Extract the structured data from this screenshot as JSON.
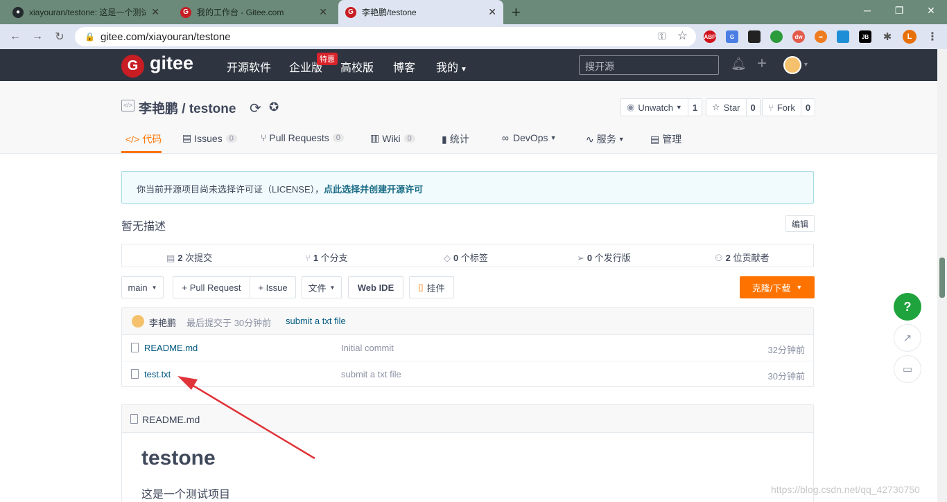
{
  "browser": {
    "tabs": [
      {
        "title": "xiayouran/testone: 这是一个测试",
        "active": false
      },
      {
        "title": "我的工作台 - Gitee.com",
        "active": false
      },
      {
        "title": "李艳鹏/testone",
        "active": true
      }
    ],
    "new_tab": "+",
    "url": "gitee.com/xiayouran/testone",
    "profile_initial": "L",
    "extensions": [
      "ABP",
      "G",
      "",
      "",
      "dw",
      "∞",
      "",
      "JB"
    ]
  },
  "header": {
    "logo": "gitee",
    "nav": [
      "开源软件",
      "企业版",
      "高校版",
      "博客",
      "我的"
    ],
    "hot_badge": "特惠",
    "search_placeholder": "搜开源"
  },
  "repo": {
    "owner": "李艳鹏",
    "separator": "/",
    "name": "testone",
    "watch": {
      "label": "Unwatch",
      "count": "1"
    },
    "star": {
      "label": "Star",
      "count": "0"
    },
    "fork": {
      "label": "Fork",
      "count": "0"
    },
    "tabs": [
      {
        "label": "代码",
        "count": null
      },
      {
        "label": "Issues",
        "count": "0"
      },
      {
        "label": "Pull Requests",
        "count": "0"
      },
      {
        "label": "Wiki",
        "count": "0"
      },
      {
        "label": "统计",
        "count": null
      },
      {
        "label": "DevOps",
        "count": null
      },
      {
        "label": "服务",
        "count": null
      },
      {
        "label": "管理",
        "count": null
      }
    ]
  },
  "notice": {
    "text": "你当前开源项目尚未选择许可证（LICENSE），",
    "link": "点此选择并创建开源许可"
  },
  "description": "暂无描述",
  "edit_label": "编辑",
  "stats": [
    {
      "num": "2",
      "label": "次提交"
    },
    {
      "num": "1",
      "label": "个分支"
    },
    {
      "num": "0",
      "label": "个标签"
    },
    {
      "num": "0",
      "label": "个发行版"
    },
    {
      "num": "2",
      "label": "位贡献者"
    }
  ],
  "toolbar": {
    "branch": "main",
    "pull_request": "+ Pull Request",
    "issue": "+ Issue",
    "files": "文件",
    "web_ide": "Web IDE",
    "widget": "挂件",
    "clone": "克隆/下载"
  },
  "last_commit": {
    "author": "李艳鹏",
    "time": "最后提交于 30分钟前",
    "message": "submit a txt file"
  },
  "files": [
    {
      "name": "README.md",
      "message": "Initial commit",
      "time": "32分钟前"
    },
    {
      "name": "test.txt",
      "message": "submit a txt file",
      "time": "30分钟前"
    }
  ],
  "readme": {
    "filename": "README.md",
    "title": "testone",
    "body": "这是一个测试项目"
  },
  "float_help": "?",
  "watermark": "https://blog.csdn.net/qq_42730750",
  "colors": {
    "accent": "#fe7300",
    "header_bg": "#2e3440",
    "brand_red": "#c71d23",
    "help_green": "#1fa33d",
    "arrow": "#e0343a"
  }
}
